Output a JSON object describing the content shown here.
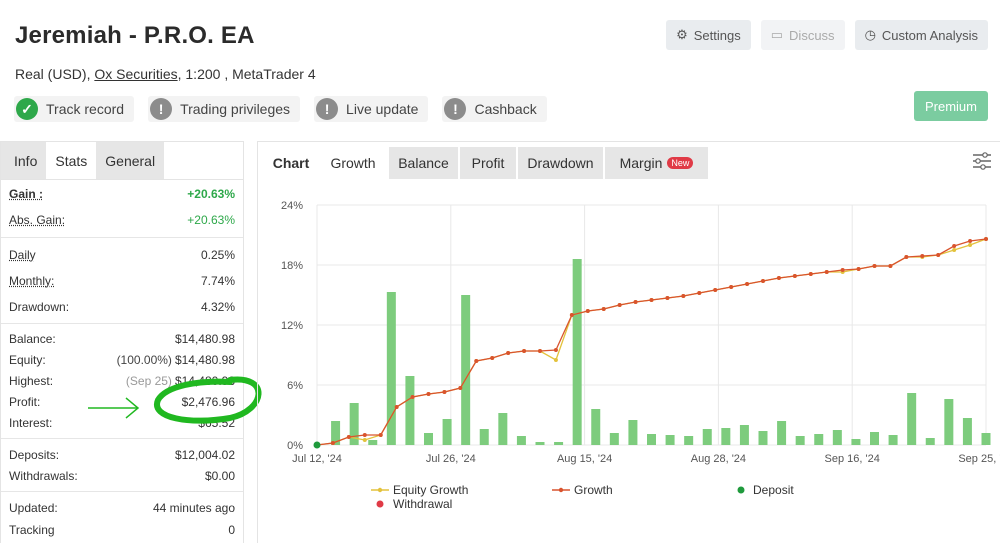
{
  "header": {
    "title": "Jeremiah - P.R.O. EA",
    "account_type": "Real (USD),",
    "broker": "Ox Securities",
    "leverage_platform": ", 1:200 , MetaTrader 4"
  },
  "badges": [
    {
      "label": "Track record",
      "status": "ok"
    },
    {
      "label": "Trading privileges",
      "status": "warn"
    },
    {
      "label": "Live update",
      "status": "warn"
    },
    {
      "label": "Cashback",
      "status": "warn"
    }
  ],
  "top_buttons": {
    "settings": "Settings",
    "discuss": "Discuss",
    "custom_analysis": "Custom Analysis",
    "premium": "Premium"
  },
  "left_tabs": [
    "Info",
    "Stats",
    "General"
  ],
  "stats": {
    "gain_label": "Gain :",
    "gain": "+20.63%",
    "abs_gain_label": "Abs. Gain:",
    "abs_gain": "+20.63%",
    "daily_label": "Daily",
    "daily": "0.25%",
    "monthly_label": "Monthly:",
    "monthly": "7.74%",
    "drawdown_label": "Drawdown:",
    "drawdown": "4.32%",
    "balance_label": "Balance:",
    "balance": "$14,480.98",
    "equity_label": "Equity:",
    "equity_pct": "(100.00%)",
    "equity": "$14,480.98",
    "highest_label": "Highest:",
    "highest_date": "(Sep 25)",
    "highest": "$14,480.98",
    "profit_label": "Profit:",
    "profit": "$2,476.96",
    "interest_label": "Interest:",
    "interest": "$65.52",
    "deposits_label": "Deposits:",
    "deposits": "$12,004.02",
    "withdrawals_label": "Withdrawals:",
    "withdrawals": "$0.00",
    "updated_label": "Updated:",
    "updated": "44 minutes ago",
    "tracking_label": "Tracking",
    "tracking": "0"
  },
  "chart_tabs": {
    "chart": "Chart",
    "growth": "Growth",
    "balance": "Balance",
    "profit": "Profit",
    "drawdown": "Drawdown",
    "margin": "Margin",
    "new_badge": "New"
  },
  "colors": {
    "bars": "#7dcc7d",
    "growth_line": "#d9542e",
    "equity_line": "#e3c23c",
    "deposit": "#1f9a3c",
    "withdrawal": "#e03a46",
    "highlight_circle": "#20b820"
  },
  "chart_data": {
    "type": "line",
    "ylim": [
      0,
      24
    ],
    "y_ticks": [
      "0%",
      "6%",
      "12%",
      "18%",
      "24%"
    ],
    "x_tick_labels": [
      "Jul 12, '24",
      "Jul 26, '24",
      "Aug 15, '24",
      "Aug 28, '24",
      "Sep 16, '24",
      "Sep 25, '24"
    ],
    "legend": [
      "Equity Growth",
      "Growth",
      "Deposit",
      "Withdrawal"
    ],
    "growth_series": [
      0.0,
      0.2,
      0.8,
      1.0,
      1.0,
      3.8,
      4.8,
      5.1,
      5.3,
      5.7,
      8.4,
      8.7,
      9.2,
      9.4,
      9.4,
      9.5,
      13.0,
      13.4,
      13.6,
      14.0,
      14.3,
      14.5,
      14.7,
      14.9,
      15.2,
      15.5,
      15.8,
      16.1,
      16.4,
      16.7,
      16.9,
      17.1,
      17.3,
      17.5,
      17.6,
      17.9,
      17.9,
      18.8,
      18.9,
      19.0,
      19.9,
      20.4,
      20.6
    ],
    "equity_series": [
      0.0,
      0.2,
      0.8,
      0.5,
      1.0,
      3.8,
      4.8,
      5.1,
      5.3,
      5.7,
      8.4,
      8.7,
      9.2,
      9.4,
      9.4,
      8.5,
      13.0,
      13.4,
      13.6,
      14.0,
      14.3,
      14.5,
      14.7,
      14.9,
      15.2,
      15.5,
      15.8,
      16.1,
      16.4,
      16.7,
      16.9,
      17.1,
      17.3,
      17.3,
      17.6,
      17.9,
      17.9,
      18.8,
      18.8,
      19.0,
      19.5,
      20.0,
      20.6
    ],
    "bar_values": [
      0.0,
      2.4,
      4.2,
      0.5,
      15.3,
      6.9,
      1.2,
      2.6,
      15.0,
      1.6,
      3.2,
      0.9,
      0.3,
      0.3,
      18.6,
      3.6,
      1.2,
      2.5,
      1.1,
      1.0,
      0.9,
      1.6,
      1.7,
      2.0,
      1.4,
      2.4,
      0.9,
      1.1,
      1.5,
      0.6,
      1.3,
      1.0,
      5.2,
      0.7,
      4.6,
      2.7,
      1.2
    ],
    "deposit_value": 0
  },
  "annotation": {
    "arrow": "→"
  }
}
